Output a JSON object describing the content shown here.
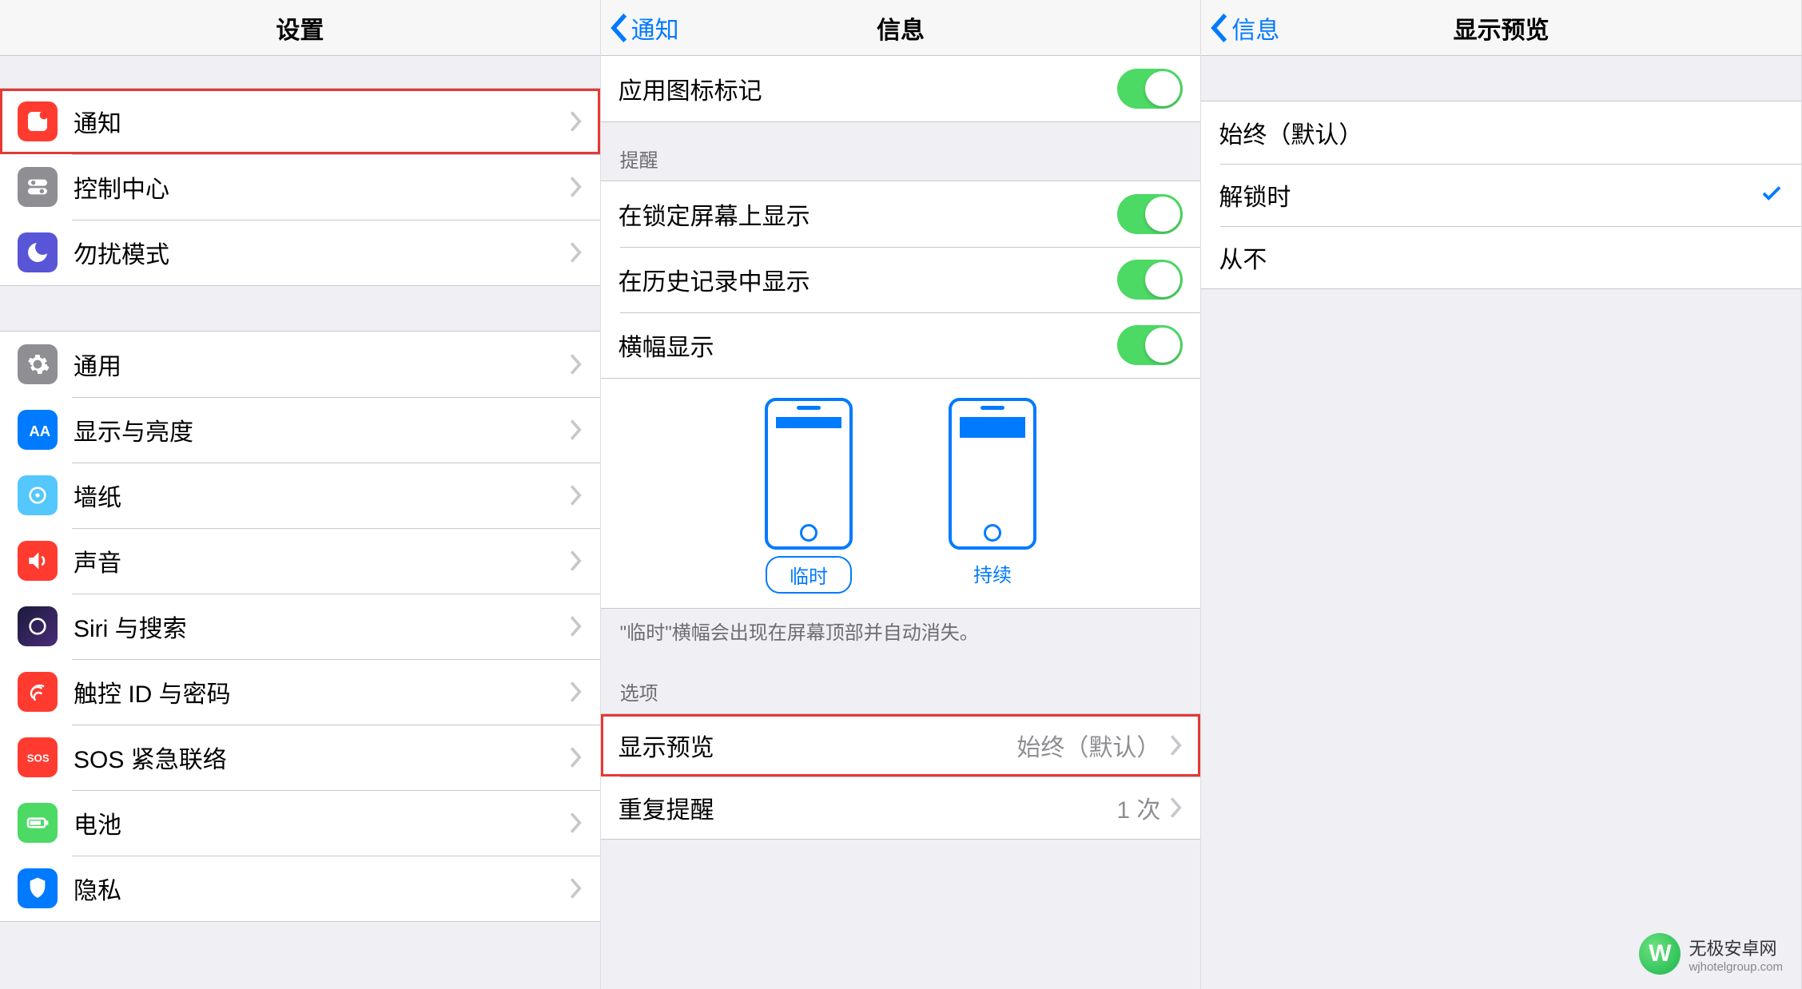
{
  "screen1": {
    "title": "设置",
    "items1": [
      {
        "label": "通知",
        "icon": "notifications"
      },
      {
        "label": "控制中心",
        "icon": "control-center"
      },
      {
        "label": "勿扰模式",
        "icon": "dnd"
      }
    ],
    "items2": [
      {
        "label": "通用",
        "icon": "general"
      },
      {
        "label": "显示与亮度",
        "icon": "display"
      },
      {
        "label": "墙纸",
        "icon": "wallpaper"
      },
      {
        "label": "声音",
        "icon": "sound"
      },
      {
        "label": "Siri 与搜索",
        "icon": "siri"
      },
      {
        "label": "触控 ID 与密码",
        "icon": "touchid"
      },
      {
        "label": "SOS 紧急联络",
        "icon": "sos"
      },
      {
        "label": "电池",
        "icon": "battery"
      },
      {
        "label": "隐私",
        "icon": "privacy"
      }
    ]
  },
  "screen2": {
    "back": "通知",
    "title": "信息",
    "badge_label": "应用图标标记",
    "alerts_header": "提醒",
    "alerts": [
      {
        "label": "在锁定屏幕上显示"
      },
      {
        "label": "在历史记录中显示"
      },
      {
        "label": "横幅显示"
      }
    ],
    "banner_temp": "临时",
    "banner_persist": "持续",
    "banner_footer": "\"临时\"横幅会出现在屏幕顶部并自动消失。",
    "options_header": "选项",
    "preview_label": "显示预览",
    "preview_value": "始终（默认）",
    "repeat_label": "重复提醒",
    "repeat_value": "1 次"
  },
  "screen3": {
    "back": "信息",
    "title": "显示预览",
    "options": [
      {
        "label": "始终（默认）",
        "selected": false
      },
      {
        "label": "解锁时",
        "selected": true
      },
      {
        "label": "从不",
        "selected": false
      }
    ]
  },
  "watermark": {
    "cn": "无极安卓网",
    "en": "wjhotelgroup.com"
  }
}
